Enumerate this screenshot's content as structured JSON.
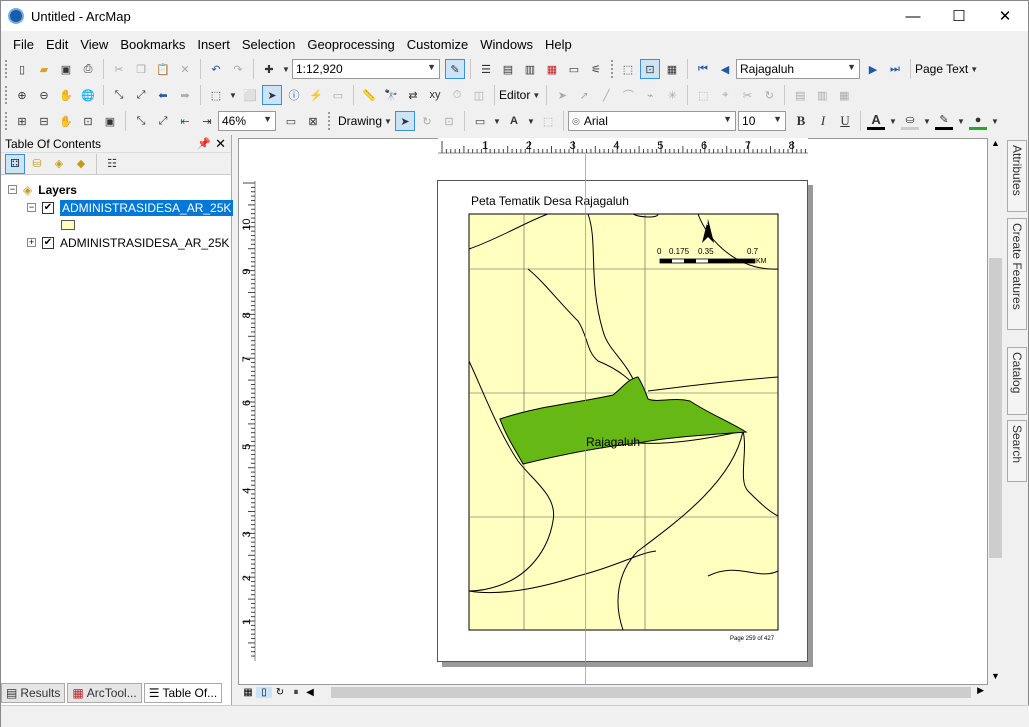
{
  "window": {
    "title": "Untitled - ArcMap",
    "min": "—",
    "max": "☐",
    "close": "✕"
  },
  "menu": [
    "File",
    "Edit",
    "View",
    "Bookmarks",
    "Insert",
    "Selection",
    "Geoprocessing",
    "Customize",
    "Windows",
    "Help"
  ],
  "toolbar": {
    "scale": "1:12,920",
    "bookmark": "Rajagaluh",
    "page_text": "Page Text",
    "editor": "Editor",
    "zoom": "46%",
    "drawing": "Drawing",
    "font": "Arial",
    "font_size": "10",
    "bold": "B",
    "italic": "I",
    "underline": "U",
    "font_color_letter": "A"
  },
  "toc": {
    "title": "Table Of Contents",
    "pin": "📌",
    "close": "✕",
    "layers_label": "Layers",
    "layer1": "ADMINISTRASIDESA_AR_25K",
    "layer2": "ADMINISTRASIDESA_AR_25K"
  },
  "bottom_tabs": [
    "Results",
    "ArcTool...",
    "Table Of..."
  ],
  "side_tabs": [
    "Attributes",
    "Create Features",
    "Catalog",
    "Search"
  ],
  "ruler_h": [
    "1",
    "2",
    "3",
    "4",
    "5",
    "6",
    "7",
    "8"
  ],
  "ruler_v": [
    "1",
    "2",
    "3",
    "4",
    "5",
    "6",
    "7",
    "8",
    "9",
    "10"
  ],
  "map": {
    "title": "Peta Tematik Desa Rajagaluh",
    "label": "Rajagaluh",
    "scale_ticks": [
      "0",
      "0.175",
      "0.35",
      "0.7"
    ],
    "scale_unit": "KM",
    "north": "N",
    "page_note": "Page 259 of 427",
    "fill_color": "#ffffc0",
    "highlight_color": "#66b814"
  }
}
